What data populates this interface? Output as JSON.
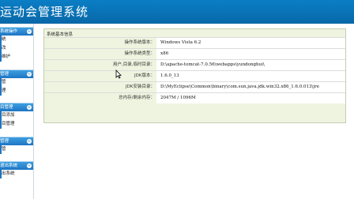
{
  "header": {
    "title": "运动会管理系统"
  },
  "sidebar": {
    "sections": [
      {
        "title": "系统操作",
        "toggle": "≈",
        "items": [
          "统",
          "改",
          "维护"
        ]
      },
      {
        "title": "管理",
        "toggle": "≈",
        "items": [
          "管",
          "理"
        ]
      },
      {
        "title": "目管理",
        "toggle": "≈",
        "items": [
          "目添加",
          "目管理"
        ]
      },
      {
        "title": "管理",
        "toggle": "≈",
        "items": [
          "管"
        ]
      },
      {
        "title": "退出系统",
        "toggle": "≈",
        "items": [
          "出系统"
        ]
      }
    ]
  },
  "panel": {
    "title": "系统基本信息",
    "rows": [
      {
        "label": "操作系统版本：",
        "value": "Windows Vista  6.2"
      },
      {
        "label": "操作系统类型：",
        "value": "x86"
      },
      {
        "label": "用户,目录,临时目录：",
        "value": "D:\\apache-tomcat-7.0.56\\webapps\\yundonghui\\"
      },
      {
        "label": "JDK版本：",
        "value": "1.6.0_13"
      },
      {
        "label": "JDK安装目录：",
        "value": "D:\\MyEclipse\\Common\\binary\\com.sun.java.jdk.win32.x86_1.6.0.013\\jre"
      },
      {
        "label": "总内存/剩余内存：",
        "value": "2047M  /  1096M"
      }
    ]
  }
}
